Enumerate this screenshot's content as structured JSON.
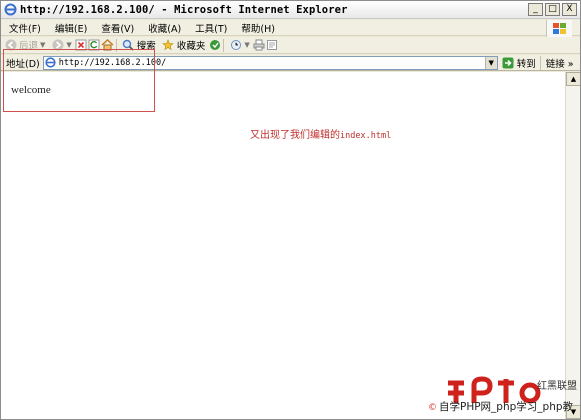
{
  "window": {
    "title": "http://192.168.2.100/ - Microsoft Internet Explorer",
    "controls": {
      "minimize": "_",
      "maximize": "□",
      "close": "X"
    }
  },
  "menu": [
    "文件(F)",
    "编辑(E)",
    "查看(V)",
    "收藏(A)",
    "工具(T)",
    "帮助(H)"
  ],
  "toolbar": {
    "back": "后退",
    "search": "搜索",
    "favorites": "收藏夹"
  },
  "address": {
    "label": "地址(D)",
    "value": "http://192.168.2.100/",
    "go": "转到",
    "links": "链接",
    "links_chevron": "»"
  },
  "page": {
    "content_text": "welcome"
  },
  "annotation": {
    "text": "又出现了我们编辑的",
    "filename": "index.html",
    "color": "#c0302c"
  },
  "watermark": {
    "tagline": "红黑联盟",
    "copyright_mark": "©",
    "line": "自学PHP网_php学习_php教",
    "accent": "#d0221d"
  }
}
